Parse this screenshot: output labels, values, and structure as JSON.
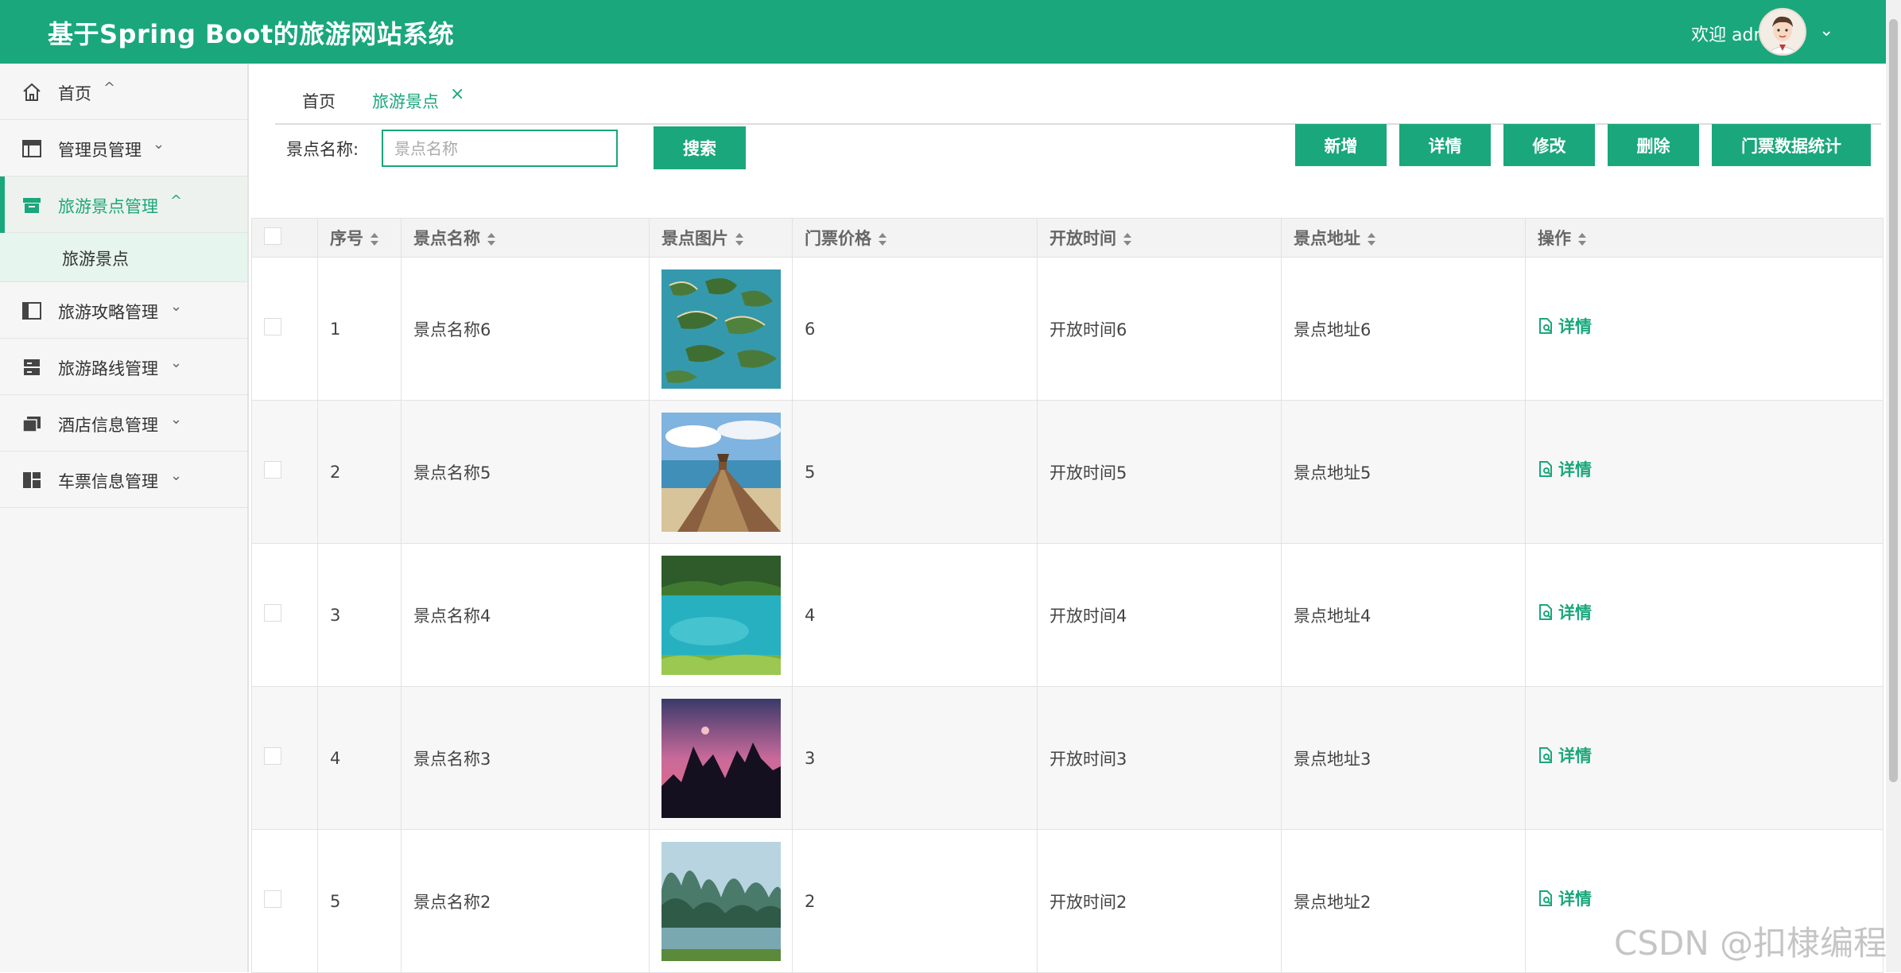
{
  "header": {
    "title": "基于Spring Boot的旅游网站系统",
    "welcome": "欢迎 admin",
    "color": "#1aa77b"
  },
  "sidebar": {
    "items": [
      {
        "label": "首页",
        "icon": "home-icon",
        "chevron": "^"
      },
      {
        "label": "管理员管理",
        "icon": "table-icon",
        "chevron": "v"
      },
      {
        "label": "旅游景点管理",
        "icon": "box-icon",
        "chevron": "^"
      },
      {
        "label": "旅游景点",
        "icon": ""
      },
      {
        "label": "旅游攻略管理",
        "icon": "columns-icon",
        "chevron": "v"
      },
      {
        "label": "旅游路线管理",
        "icon": "server-icon",
        "chevron": "v"
      },
      {
        "label": "酒店信息管理",
        "icon": "folders-icon",
        "chevron": "v"
      },
      {
        "label": "车票信息管理",
        "icon": "dashboard-icon",
        "chevron": "v"
      }
    ]
  },
  "tabs": [
    {
      "label": "首页"
    },
    {
      "label": "旅游景点",
      "close": "×"
    }
  ],
  "search": {
    "label": "景点名称:",
    "placeholder": "景点名称",
    "button": "搜索"
  },
  "toolbar": {
    "add": "新增",
    "detail": "详情",
    "edit": "修改",
    "delete": "删除",
    "stats": "门票数据统计"
  },
  "table": {
    "columns": [
      "序号",
      "景点名称",
      "景点图片",
      "门票价格",
      "开放时间",
      "景点地址",
      "操作"
    ],
    "rows": [
      {
        "no": "1",
        "name": "景点名称6",
        "price": "6",
        "time": "开放时间6",
        "addr": "景点地址6",
        "op": "详情",
        "image": "islands-photo"
      },
      {
        "no": "2",
        "name": "景点名称5",
        "price": "5",
        "time": "开放时间5",
        "addr": "景点地址5",
        "op": "详情",
        "image": "pier-photo"
      },
      {
        "no": "3",
        "name": "景点名称4",
        "price": "4",
        "time": "开放时间4",
        "addr": "景点地址4",
        "op": "详情",
        "image": "lake-photo"
      },
      {
        "no": "4",
        "name": "景点名称3",
        "price": "3",
        "time": "开放时间3",
        "addr": "景点地址3",
        "op": "详情",
        "image": "sunset-mountains-photo"
      },
      {
        "no": "5",
        "name": "景点名称2",
        "price": "2",
        "time": "开放时间2",
        "addr": "景点地址2",
        "op": "详情",
        "image": "karst-river-photo"
      }
    ]
  },
  "watermark": "CSDN @扣棣编程"
}
